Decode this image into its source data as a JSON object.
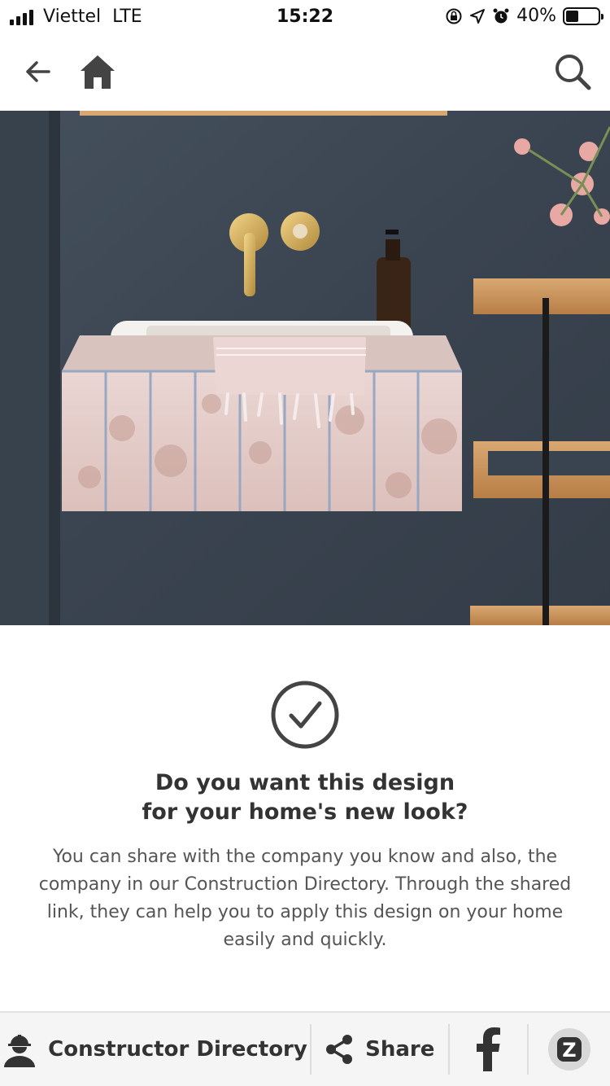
{
  "status_bar": {
    "carrier": "Viettel",
    "network": "LTE",
    "time": "15:22",
    "battery": "40%",
    "battery_level": 0.4
  },
  "nav": {
    "back_icon": "back-arrow-icon",
    "home_icon": "home-icon",
    "search_icon": "search-icon"
  },
  "hero": {
    "subject": "bathroom-sink-photo"
  },
  "content": {
    "title_line1": "Do you want this design",
    "title_line2": "for your home's new look?",
    "description": "You can share with the company you know and also, the company in our Construction Directory. Through the shared link, they can help you to apply this design on your home easily and quickly."
  },
  "toolbar": {
    "directory_label": "Constructor Directory",
    "share_label": "Share",
    "facebook_icon": "facebook-icon",
    "zalo_icon": "zalo-icon",
    "zalo_letter": "Z"
  },
  "colors": {
    "text_dark": "#333333",
    "text_body": "#555555",
    "toolbar_bg": "#f5f5f5",
    "check_ring": "#444444"
  }
}
